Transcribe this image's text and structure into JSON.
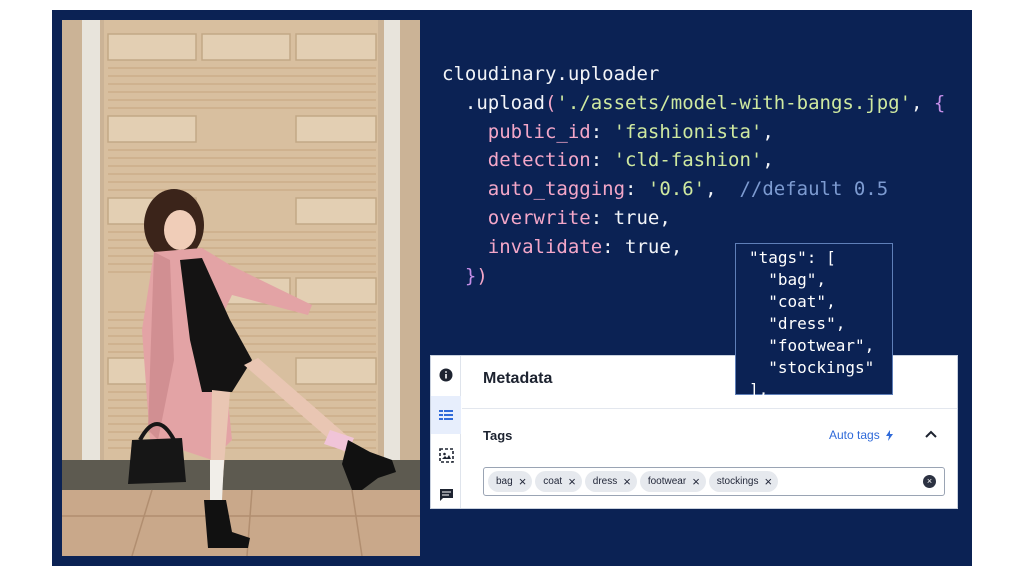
{
  "code": {
    "lines": [
      [
        {
          "t": "cloudinary.uploader",
          "c": "c-white"
        }
      ],
      [
        {
          "t": "  .upload",
          "c": "c-white"
        },
        {
          "t": "(",
          "c": "c-pink"
        },
        {
          "t": "'./assets/model-with-bangs.jpg'",
          "c": "c-green"
        },
        {
          "t": ", ",
          "c": "c-white"
        },
        {
          "t": "{",
          "c": "c-purple"
        }
      ],
      [
        {
          "t": "    public_id",
          "c": "c-pink"
        },
        {
          "t": ": ",
          "c": "c-white"
        },
        {
          "t": "'fashionista'",
          "c": "c-green"
        },
        {
          "t": ",",
          "c": "c-white"
        }
      ],
      [
        {
          "t": "    detection",
          "c": "c-pink"
        },
        {
          "t": ": ",
          "c": "c-white"
        },
        {
          "t": "'cld-fashion'",
          "c": "c-green"
        },
        {
          "t": ",",
          "c": "c-white"
        }
      ],
      [
        {
          "t": "    auto_tagging",
          "c": "c-pink"
        },
        {
          "t": ": ",
          "c": "c-white"
        },
        {
          "t": "'0.6'",
          "c": "c-green"
        },
        {
          "t": ",  ",
          "c": "c-white"
        },
        {
          "t": "//default 0.5",
          "c": "c-comment"
        }
      ],
      [
        {
          "t": "    overwrite",
          "c": "c-pink"
        },
        {
          "t": ": ",
          "c": "c-white"
        },
        {
          "t": "true",
          "c": "c-white"
        },
        {
          "t": ",",
          "c": "c-white"
        }
      ],
      [
        {
          "t": "    invalidate",
          "c": "c-pink"
        },
        {
          "t": ": ",
          "c": "c-white"
        },
        {
          "t": "true",
          "c": "c-white"
        },
        {
          "t": ",",
          "c": "c-white"
        }
      ],
      [
        {
          "t": "  ",
          "c": "c-white"
        },
        {
          "t": "}",
          "c": "c-purple"
        },
        {
          "t": ")",
          "c": "c-pink"
        }
      ]
    ]
  },
  "json_overlay": {
    "lines": [
      "\"tags\": [",
      "  \"bag\",",
      "  \"coat\",",
      "  \"dress\",",
      "  \"footwear\",",
      "  \"stockings\"",
      "],"
    ]
  },
  "panel": {
    "title": "Metadata",
    "tags_label": "Tags",
    "auto_tags_label": "Auto tags",
    "tags": [
      "bag",
      "coat",
      "dress",
      "footwear",
      "stockings"
    ],
    "chip_remove_glyph": "×",
    "clear_glyph": "×",
    "rail_icons": [
      "info-icon",
      "metadata-list-icon",
      "image-analysis-icon",
      "comments-icon"
    ]
  },
  "colors": {
    "background": "#0b2254",
    "accent_link": "#2f6ad9",
    "active_rail": "#e7eefc"
  }
}
